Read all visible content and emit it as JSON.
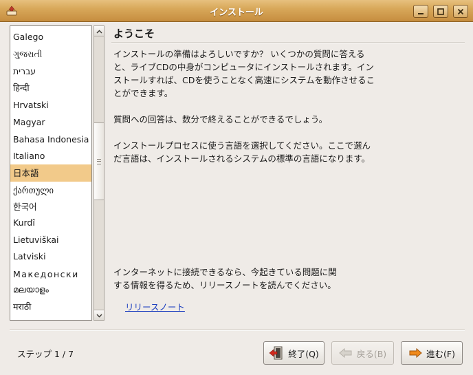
{
  "window": {
    "title": "インストール",
    "controls": {
      "minimize": "minimize-icon",
      "maximize": "maximize-icon",
      "close": "close-icon"
    }
  },
  "languages": {
    "items": [
      {
        "label": "Galego"
      },
      {
        "label": "ગુજરાતી"
      },
      {
        "label": "עברית"
      },
      {
        "label": "हिन्दी"
      },
      {
        "label": "Hrvatski"
      },
      {
        "label": "Magyar"
      },
      {
        "label": "Bahasa Indonesia"
      },
      {
        "label": "Italiano"
      },
      {
        "label": "日本語"
      },
      {
        "label": "ქართული"
      },
      {
        "label": "한국어"
      },
      {
        "label": "Kurdî"
      },
      {
        "label": "Lietuviškai"
      },
      {
        "label": "Latviski"
      },
      {
        "label": "Македонски"
      },
      {
        "label": "മലയാളം"
      },
      {
        "label": "मराठी"
      }
    ],
    "selected": "日本語",
    "scroll_position": 0.33
  },
  "content": {
    "heading": "ようこそ",
    "paragraph1_lines": [
      "インストールの準備はよろしいですか？ いくつかの質問に答える",
      "と、ライブCDの中身がコンピュータにインストールされます。イン",
      "ストールすれば、CDを使うことなく高速にシステムを動作させるこ",
      "とができます。"
    ],
    "paragraph2": "質問への回答は、数分で終えることができるでしょう。",
    "paragraph3_lines": [
      "インストールプロセスに使う言語を選択してください。ここで選ん",
      "だ言語は、インストールされるシステムの標準の言語になります。"
    ],
    "paragraph4_lines": [
      "インターネットに接続できるなら、今起きている問題に関",
      "する情報を得るため、リリースノートを読んでください。"
    ],
    "release_notes_link": "リリースノート"
  },
  "footer": {
    "step": "ステップ 1 / 7",
    "quit_label": "終了(Q)",
    "back_label": "戻る(B)",
    "next_label": "進む(F)"
  },
  "colors": {
    "titlebar": "#d8a85a",
    "selection": "#f2ca8a",
    "link": "#1d3fbf",
    "background": "#efebe7"
  }
}
